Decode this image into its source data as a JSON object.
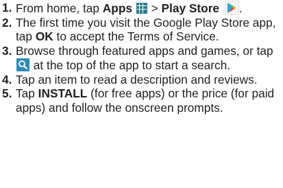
{
  "steps": [
    {
      "number": "1.",
      "parts": {
        "a": "From home, tap ",
        "b": "Apps",
        "c": " > ",
        "d": "Play Store",
        "e": "."
      }
    },
    {
      "number": "2.",
      "parts": {
        "a": "The first time you visit the Google Play Store app, tap ",
        "b": "OK",
        "c": " to accept the Terms of Service."
      }
    },
    {
      "number": "3.",
      "parts": {
        "a": "Browse through featured apps and games, or tap ",
        "b": " at the top of the app to start a search."
      }
    },
    {
      "number": "4.",
      "parts": {
        "a": "Tap an item to read a description and reviews."
      }
    },
    {
      "number": "5.",
      "parts": {
        "a": "Tap ",
        "b": "INSTALL",
        "c": " (for free apps) or the price (for paid apps) and follow the onscreen prompts."
      }
    }
  ],
  "icons": {
    "apps": "apps-grid-icon",
    "play_store": "play-store-icon",
    "search": "search-icon"
  },
  "colors": {
    "apps_icon": "#2f7d8c",
    "search_icon": "#2d8bb3",
    "text": "#1f1f1f"
  }
}
